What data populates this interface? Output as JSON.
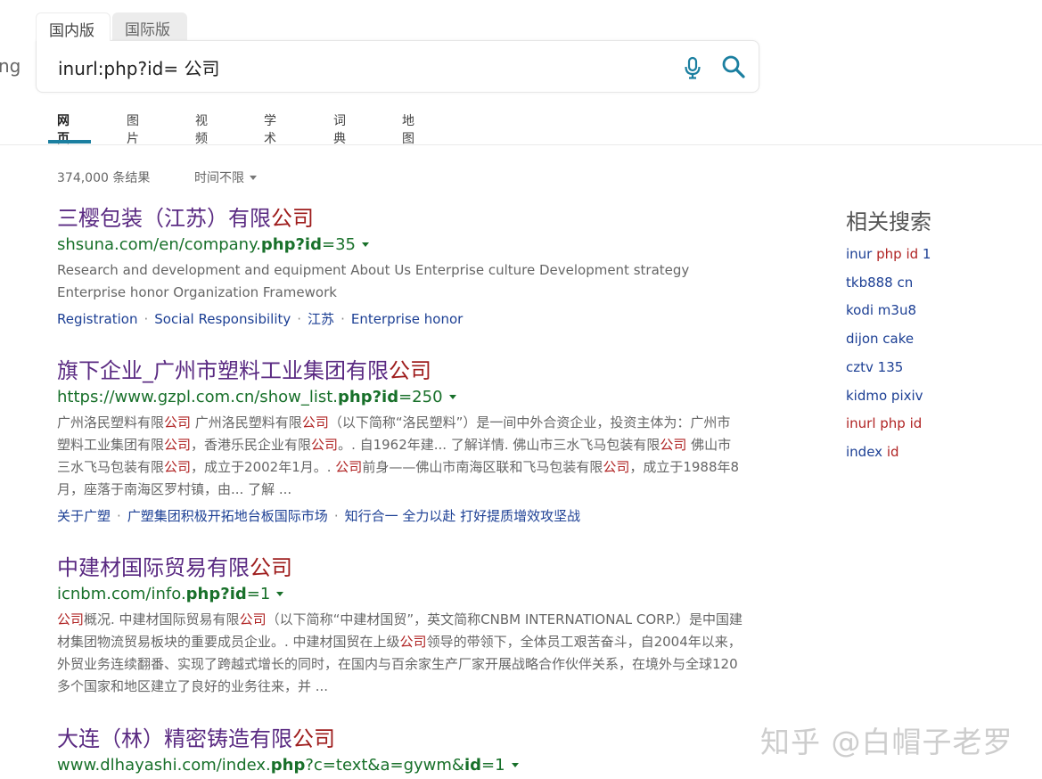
{
  "logo_fragment": "ng",
  "market_tabs": [
    "国内版",
    "国际版"
  ],
  "search": {
    "query": "inurl:php?id= 公司",
    "mic_icon": "microphone-icon",
    "search_icon": "search-icon",
    "accent_color": "#1b7fa0"
  },
  "scope_tabs": [
    "网页",
    "图片",
    "视频",
    "学术",
    "词典",
    "地图"
  ],
  "result_count": "374,000 条结果",
  "time_filter": "时间不限",
  "results": [
    {
      "title": "三樱包装（江苏）有限",
      "title_hl": "公司",
      "url_pre": "shsuna.com/en/company.",
      "url_b1": "php?id",
      "url_mid": "=35",
      "url_b2": "",
      "url_post": "",
      "snippet": [
        {
          "t": "Research and development and equipment About Us Enterprise culture Development strategy Enterprise honor Organization Framework",
          "hl": false
        }
      ],
      "deeplinks": [
        "Registration",
        "Social Responsibility",
        "江苏",
        "Enterprise honor"
      ]
    },
    {
      "title": "旗下企业_广州市塑料工业集团有限",
      "title_hl": "公司",
      "url_pre": "https://www.gzpl.com.cn/show_list.",
      "url_b1": "php?id",
      "url_mid": "=250",
      "url_b2": "",
      "url_post": "",
      "snippet": [
        {
          "t": "广州洛民塑料有限",
          "hl": false
        },
        {
          "t": "公司",
          "hl": true
        },
        {
          "t": " 广州洛民塑料有限",
          "hl": false
        },
        {
          "t": "公司",
          "hl": true
        },
        {
          "t": "（以下简称“洛民塑料”）是一间中外合资企业，投资主体为：广州市塑料工业集团有限",
          "hl": false
        },
        {
          "t": "公司",
          "hl": true
        },
        {
          "t": "，香港乐民企业有限",
          "hl": false
        },
        {
          "t": "公司",
          "hl": true
        },
        {
          "t": "。. 自1962年建... 了解详情. 佛山市三水飞马包装有限",
          "hl": false
        },
        {
          "t": "公司",
          "hl": true
        },
        {
          "t": " 佛山市三水飞马包装有限",
          "hl": false
        },
        {
          "t": "公司",
          "hl": true
        },
        {
          "t": "，成立于2002年1月。. ",
          "hl": false
        },
        {
          "t": "公司",
          "hl": true
        },
        {
          "t": "前身——佛山市南海区联和飞马包装有限",
          "hl": false
        },
        {
          "t": "公司",
          "hl": true
        },
        {
          "t": "，成立于1988年8月，座落于南海区罗村镇，由... 了解 ...",
          "hl": false
        }
      ],
      "deeplinks": [
        "关于广塑",
        "广塑集团积极开拓地台板国际市场",
        "知行合一 全力以赴 打好提质增效攻坚战"
      ]
    },
    {
      "title": "中建材国际贸易有限",
      "title_hl": "公司",
      "url_pre": "icnbm.com/info.",
      "url_b1": "php?id",
      "url_mid": "=1",
      "url_b2": "",
      "url_post": "",
      "snippet": [
        {
          "t": "公司",
          "hl": true
        },
        {
          "t": "概况. 中建材国际贸易有限",
          "hl": false
        },
        {
          "t": "公司",
          "hl": true
        },
        {
          "t": "（以下简称“中建材国贸”，英文简称CNBM INTERNATIONAL CORP.）是中国建材集团物流贸易板块的重要成员企业。. 中建材国贸在上级",
          "hl": false
        },
        {
          "t": "公司",
          "hl": true
        },
        {
          "t": "领导的带领下，全体员工艰苦奋斗，自2004年以来，外贸业务连续翻番、实现了跨越式增长的同时，在国内与百余家生产厂家开展战略合作伙伴关系，在境外与全球120多个国家和地区建立了良好的业务往来，并 ...",
          "hl": false
        }
      ],
      "deeplinks": []
    },
    {
      "title": "大连（林）精密铸造有限",
      "title_hl": "公司",
      "url_pre": "www.dlhayashi.com/index.",
      "url_b1": "php",
      "url_mid": "?c=text&a=gywm&",
      "url_b2": "id",
      "url_post": "=1",
      "snippet": [],
      "deeplinks": []
    }
  ],
  "related": {
    "title": "相关搜索",
    "items": [
      {
        "pre": "inur ",
        "hl": "php id",
        "post": " 1"
      },
      {
        "pre": "tkb888 cn",
        "hl": "",
        "post": ""
      },
      {
        "pre": "kodi m3u8",
        "hl": "",
        "post": ""
      },
      {
        "pre": "dijon cake",
        "hl": "",
        "post": ""
      },
      {
        "pre": "cztv 135",
        "hl": "",
        "post": ""
      },
      {
        "pre": "kidmo pixiv",
        "hl": "",
        "post": ""
      },
      {
        "pre": "",
        "hl": "inurl php id",
        "post": ""
      },
      {
        "pre": "index ",
        "hl": "id",
        "post": ""
      }
    ]
  },
  "watermark": "知乎 @白帽子老罗"
}
